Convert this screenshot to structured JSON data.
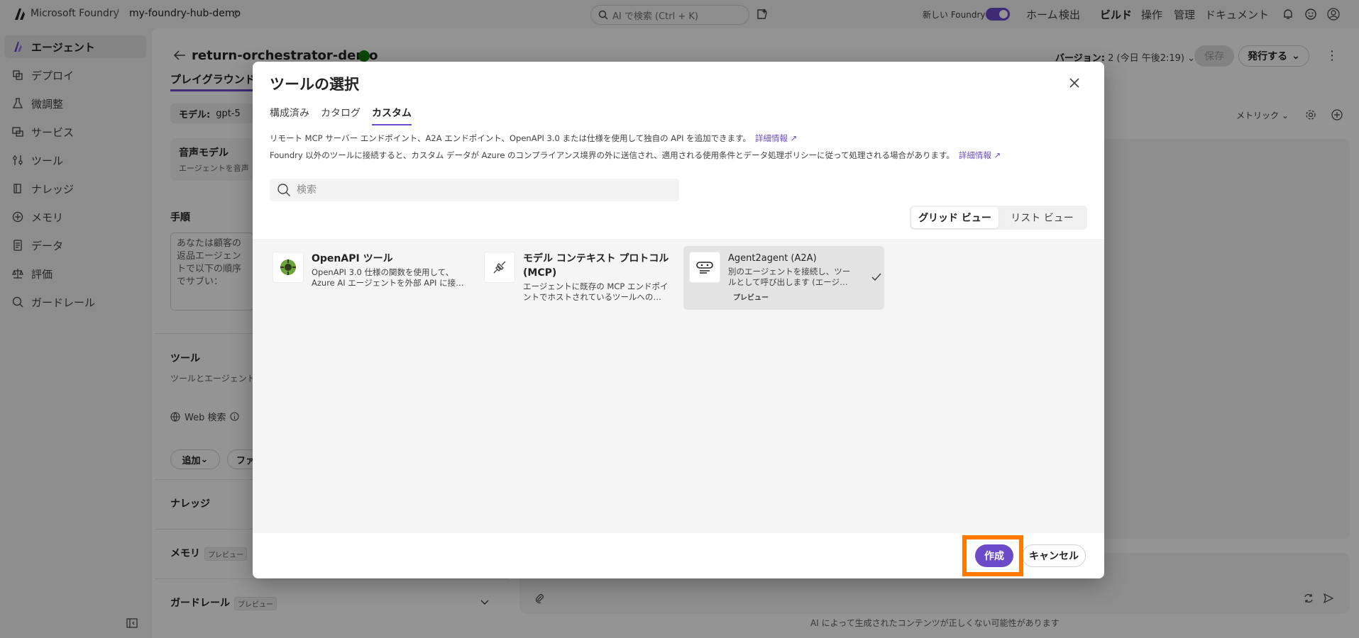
{
  "topbar": {
    "brand": "Microsoft Foundry",
    "separator": "/",
    "hub": "my-foundry-hub-demo",
    "search_placeholder": "AI で検索 (Ctrl + K)",
    "new_foundry_label": "新しい Foundry",
    "nav": [
      "ホーム",
      "検出",
      "ビルド",
      "操作",
      "管理",
      "ドキュメント"
    ],
    "active_nav": "ビルド"
  },
  "sidebar": {
    "items": [
      {
        "label": "エージェント",
        "icon": "agent-icon"
      },
      {
        "label": "デプロイ",
        "icon": "deploy-icon"
      },
      {
        "label": "微調整",
        "icon": "flask-icon"
      },
      {
        "label": "サービス",
        "icon": "service-icon"
      },
      {
        "label": "ツール",
        "icon": "tools-icon"
      },
      {
        "label": "ナレッジ",
        "icon": "knowledge-icon"
      },
      {
        "label": "メモリ",
        "icon": "memory-icon"
      },
      {
        "label": "データ",
        "icon": "data-icon"
      },
      {
        "label": "評価",
        "icon": "evaluation-icon"
      },
      {
        "label": "ガードレール",
        "icon": "guardrail-icon"
      }
    ]
  },
  "agent": {
    "title": "return-orchestrator-demo",
    "tab_playground": "プレイグラウンド",
    "version_label": "バージョン:",
    "version_value": "2 (今日 午後2:19)",
    "save_label": "保存",
    "publish_label": "発行する",
    "model_label": "モデル:",
    "model_value": "gpt-5",
    "voice_title": "音声モデル",
    "voice_sub": "エージェントを音声",
    "instructions_label": "手順",
    "instructions_text": "あなたは顧客の返品エージェントで以下の順序でサブい：",
    "tools_label": "ツール",
    "tools_desc": "ツールとエージェントを利用して入力トーク",
    "web_search": "Web 検索",
    "add_label": "追加",
    "file_label": "ファ",
    "knowledge_label": "ナレッジ",
    "memory_label": "メモリ",
    "guardrail_label": "ガードレール",
    "preview_badge": "プレビュー",
    "metrics_label": "メトリック",
    "disclaimer": "AI によって生成されたコンテンツが正しくない可能性があります"
  },
  "dialog": {
    "title": "ツールの選択",
    "tabs": [
      "構成済み",
      "カタログ",
      "カスタム"
    ],
    "active_tab": "カスタム",
    "desc1": "リモート MCP サーバー エンドポイント、A2A エンドポイント、OpenAPI 3.0 または仕様を使用して独自の API を追加できます。",
    "desc2": "Foundry 以外のツールに接続すると、カスタム データが Azure のコンプライアンス境界の外に送信され、適用される使用条件とデータ処理ポリシーに従って処理される場合があります。",
    "link_label": "詳細情報",
    "search_placeholder": "検索",
    "view_grid": "グリッド ビュー",
    "view_list": "リスト ビュー",
    "cards": [
      {
        "title": "OpenAPI ツール",
        "desc": "OpenAPI 3.0 仕様の関数を使用して、Azure AI エージェントを外部 API に接…",
        "icon": "openapi-icon"
      },
      {
        "title": "モデル コンテキスト プロトコル (MCP)",
        "desc": "エージェントに既存の MCP エンドポイントでホストされているツールへの…",
        "icon": "mcp-plug-icon"
      },
      {
        "title": "Agent2agent (A2A)",
        "desc": "別のエージェントを接続し、ツールとして呼び出します (エージ…",
        "tag": "プレビュー",
        "icon": "a2a-icon",
        "selected": true
      }
    ],
    "create_label": "作成",
    "cancel_label": "キャンセル"
  },
  "colors": {
    "accent": "#6b4bc7",
    "highlight": "#ff7a00"
  }
}
